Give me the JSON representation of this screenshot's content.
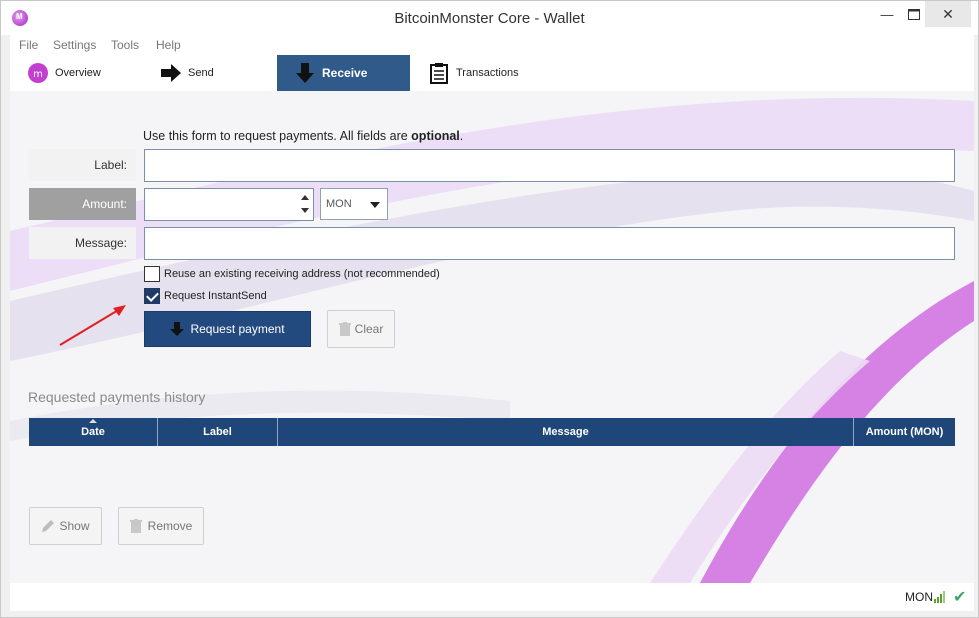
{
  "window": {
    "title": "BitcoinMonster Core - Wallet"
  },
  "menu": [
    "File",
    "Settings",
    "Tools",
    "Help"
  ],
  "toolbar": {
    "overview": "Overview",
    "send": "Send",
    "receive": "Receive",
    "transactions": "Transactions",
    "active": "Receive"
  },
  "form": {
    "instruction_prefix": "Use this form to request payments. All fields are ",
    "instruction_bold": "optional",
    "instruction_suffix": ".",
    "label_label": "Label:",
    "label_value": "",
    "amount_label": "Amount:",
    "amount_value": "",
    "unit": "MON",
    "message_label": "Message:",
    "message_value": "",
    "reuse_address": {
      "label": "Reuse an existing receiving address (not recommended)",
      "checked": false
    },
    "instantsend": {
      "label": "Request InstantSend",
      "checked": true
    },
    "request_button": "Request payment",
    "clear_button": "Clear"
  },
  "history": {
    "title": "Requested payments history",
    "columns": [
      "Date",
      "Label",
      "Message",
      "Amount (MON)"
    ],
    "rows": [],
    "show_button": "Show",
    "remove_button": "Remove"
  },
  "status": {
    "unit": "MON"
  },
  "colors": {
    "accent": "#234a7e",
    "header": "#1f4678",
    "annotation_arrow": "#e02020"
  }
}
